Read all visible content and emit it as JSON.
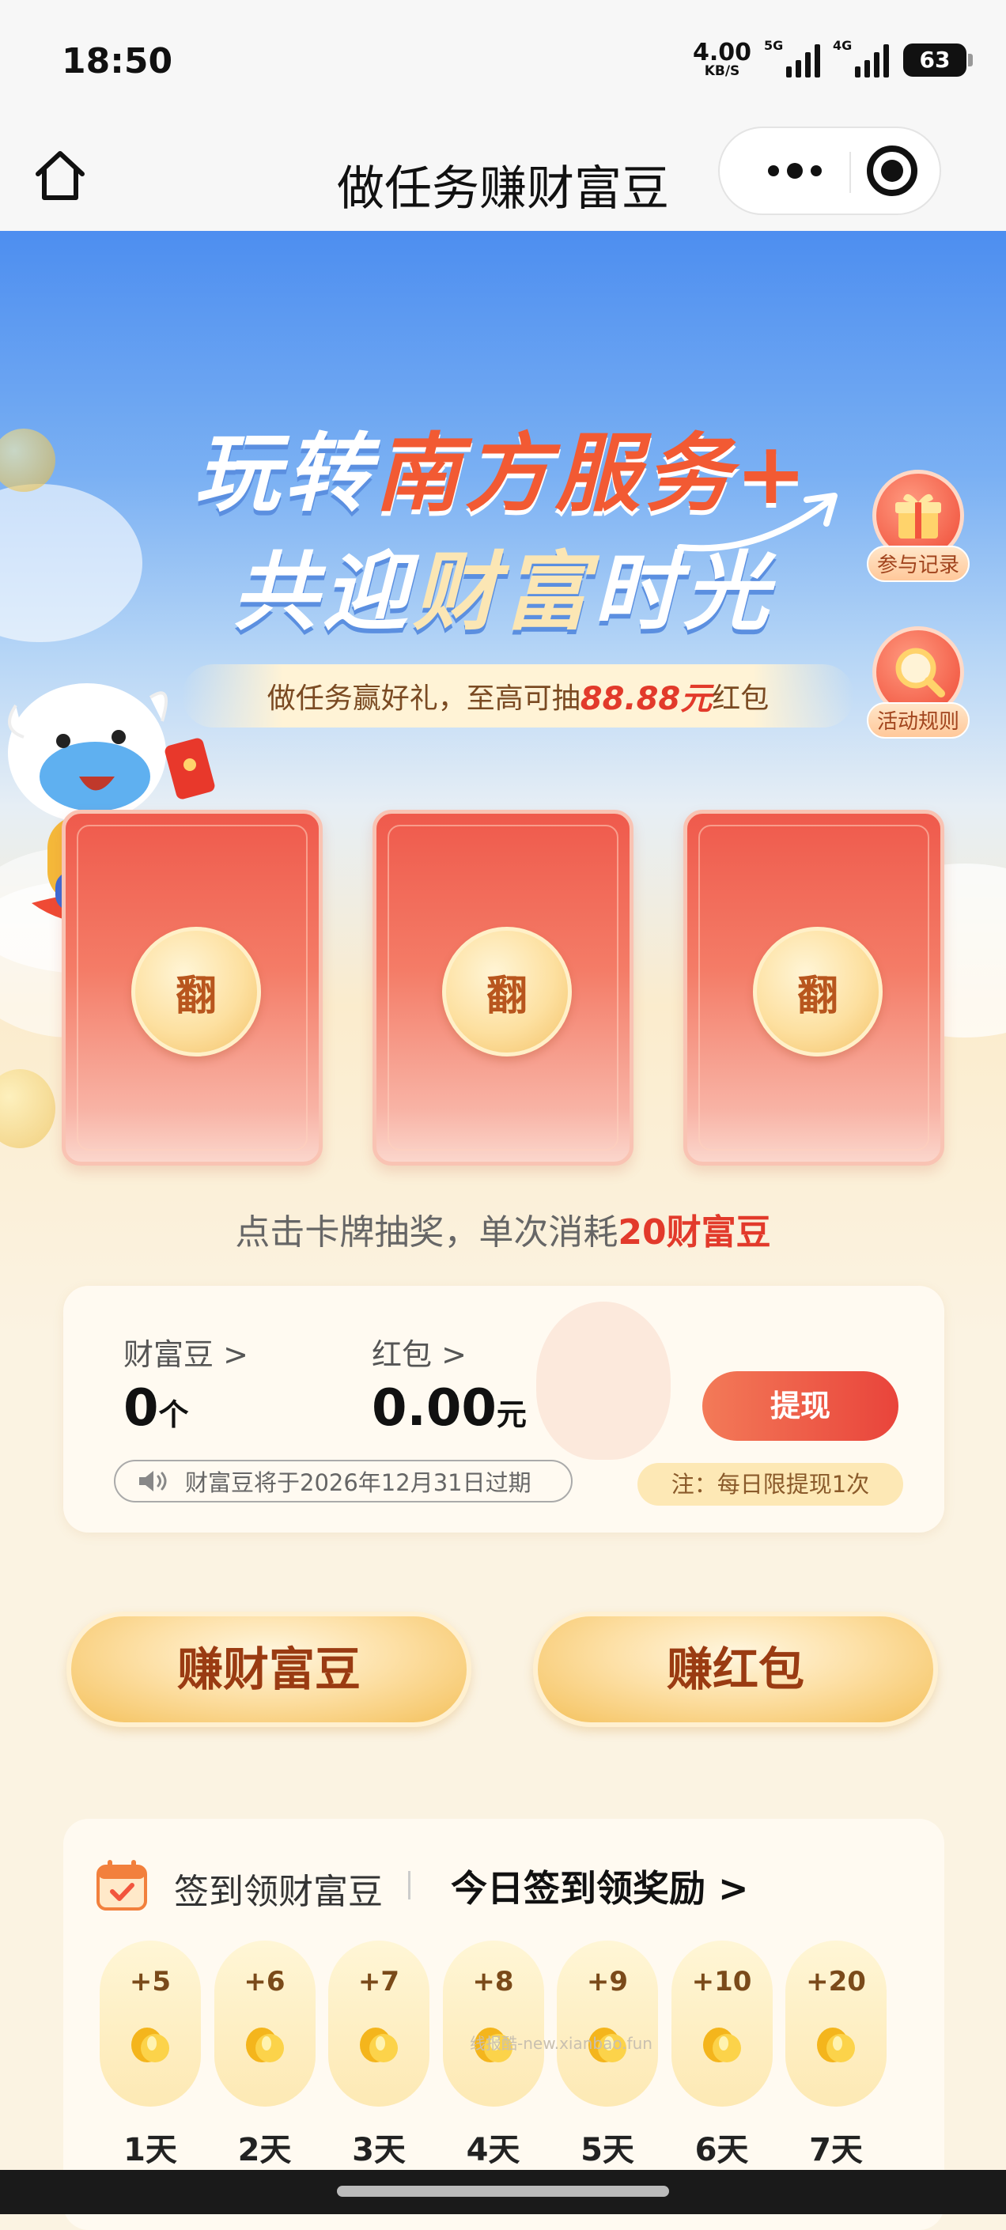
{
  "status_bar": {
    "time": "18:50",
    "net_speed_value": "4.00",
    "net_speed_unit": "KB/S",
    "sim1_label": "5G",
    "sim2_label": "4G",
    "battery": "63"
  },
  "nav": {
    "title": "做任务赚财富豆",
    "home_icon": "home-icon",
    "more_icon": "more-icon",
    "close_icon": "target-icon"
  },
  "hero": {
    "line1_a": "玩转",
    "line1_b": "南方服务+",
    "line2_a": "共迎",
    "line2_b": "财富",
    "line2_c": "时光",
    "subtitle_prefix": "做任务赢好礼，至高可抽",
    "subtitle_amount": "88.88元",
    "subtitle_suffix": "红包",
    "side_record": "参与记录",
    "side_rules": "活动规则"
  },
  "cards": [
    {
      "label": "翻"
    },
    {
      "label": "翻"
    },
    {
      "label": "翻"
    }
  ],
  "hint": {
    "prefix": "点击卡牌抽奖，单次消耗",
    "cost": "20财富豆"
  },
  "balance": {
    "beans_label": "财富豆 >",
    "beans_value": "0",
    "beans_unit": "个",
    "redpacket_label": "红包 >",
    "redpacket_value": "0.00",
    "redpacket_unit": "元",
    "withdraw_label": "提现",
    "expire_text": "财富豆将于2026年12月31日过期",
    "note_text": "注：每日限提现1次"
  },
  "earn": {
    "beans_button": "赚财富豆",
    "redpacket_button": "赚红包"
  },
  "sign_in": {
    "title": "签到领财富豆",
    "today_link": "今日签到领奖励 >",
    "days": [
      {
        "points": "+5",
        "label": "1天"
      },
      {
        "points": "+6",
        "label": "2天"
      },
      {
        "points": "+7",
        "label": "3天"
      },
      {
        "points": "+8",
        "label": "4天"
      },
      {
        "points": "+9",
        "label": "5天"
      },
      {
        "points": "+10",
        "label": "6天"
      },
      {
        "points": "+20",
        "label": "7天"
      }
    ],
    "watermark": "线报酷-new.xianbao.fun"
  },
  "colors": {
    "accent_red": "#e23a2b",
    "sky_blue": "#4d8ef0",
    "gold": "#f4c15c"
  }
}
